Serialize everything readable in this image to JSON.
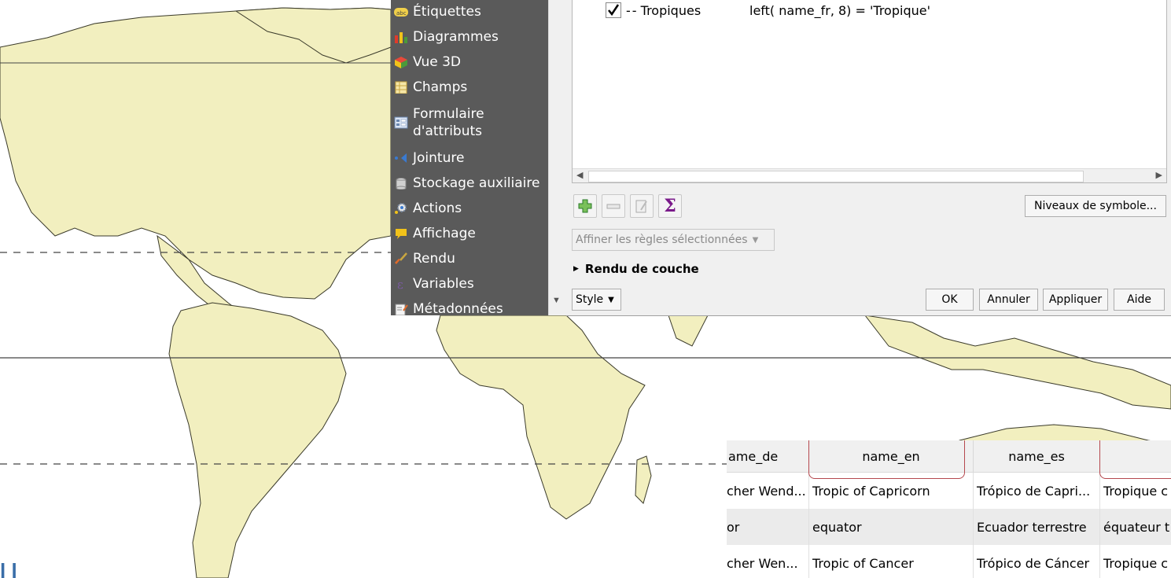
{
  "menu": {
    "items": [
      {
        "label": "Étiquettes",
        "icon": "labels-icon"
      },
      {
        "label": "Diagrammes",
        "icon": "diagrams-icon"
      },
      {
        "label": "Vue 3D",
        "icon": "cube-3d-icon"
      },
      {
        "label": "Champs",
        "icon": "fields-icon"
      },
      {
        "label": "Formulaire",
        "label2": "d'attributs",
        "icon": "form-icon"
      },
      {
        "label": "Jointure",
        "icon": "join-icon"
      },
      {
        "label": "Stockage auxiliaire",
        "icon": "storage-icon"
      },
      {
        "label": "Actions",
        "icon": "actions-gear-icon"
      },
      {
        "label": "Affichage",
        "icon": "speech-bubble-icon"
      },
      {
        "label": "Rendu",
        "icon": "brush-icon"
      },
      {
        "label": "Variables",
        "icon": "variables-icon"
      },
      {
        "label": "Métadonnées",
        "icon": "metadata-icon"
      }
    ]
  },
  "rules": {
    "row": {
      "label": "- Tropiques",
      "filter": "left( name_fr, 8) = 'Tropique'"
    }
  },
  "toolbar": {
    "symbol_levels": "Niveaux de symbole...",
    "refine_rules": "Affiner les règles sélectionnées",
    "section": "Rendu de couche",
    "style": "Style",
    "ok": "OK",
    "cancel": "Annuler",
    "apply": "Appliquer",
    "help": "Aide"
  },
  "table": {
    "headers": [
      "ame_de",
      "name_en",
      "name_es",
      ""
    ],
    "rows": [
      [
        "cher Wend...",
        "Tropic of Capricorn",
        "Trópico de Capri...",
        "Tropique c"
      ],
      [
        "or",
        "equator",
        "Ecuador terrestre",
        "équateur t"
      ],
      [
        "cher Wen...",
        "Tropic of Cancer",
        "Trópico de Cáncer",
        "Tropique c"
      ]
    ]
  },
  "colors": {
    "land": "#f2efbf",
    "coast": "#3a3a2a",
    "menu_bg": "#5a5a5a",
    "highlight": "#b5484e",
    "sigma": "#7a1a8a"
  }
}
